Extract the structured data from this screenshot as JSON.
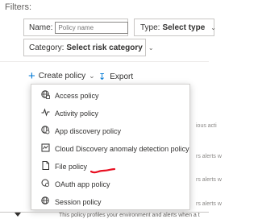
{
  "filters": {
    "heading": "Filters:",
    "name_label": "Name:",
    "name_placeholder": "Policy name",
    "type_label": "Type:",
    "type_value": "Select type",
    "category_label": "Category:",
    "category_value": "Select risk category"
  },
  "toolbar": {
    "create_label": "Create policy",
    "export_label": "Export"
  },
  "menu": {
    "items": [
      {
        "label": "Access policy",
        "icon": "globe-lock-icon"
      },
      {
        "label": "Activity policy",
        "icon": "activity-icon"
      },
      {
        "label": "App discovery policy",
        "icon": "globe-search-icon"
      },
      {
        "label": "Cloud Discovery anomaly detection policy",
        "icon": "anomaly-icon"
      },
      {
        "label": "File policy",
        "icon": "file-icon"
      },
      {
        "label": "OAuth app policy",
        "icon": "oauth-icon"
      },
      {
        "label": "Session policy",
        "icon": "globe-session-icon"
      }
    ]
  },
  "background_rows": [
    {
      "text": "ious acti"
    },
    {
      "text": "rs alerts w"
    },
    {
      "text": "rs alerts w"
    },
    {
      "text": "rs alerts w"
    }
  ],
  "footer_text": "This policy profiles your environment and alerts when a t",
  "colors": {
    "accent": "#0078d4",
    "annotation": "#e81123"
  }
}
